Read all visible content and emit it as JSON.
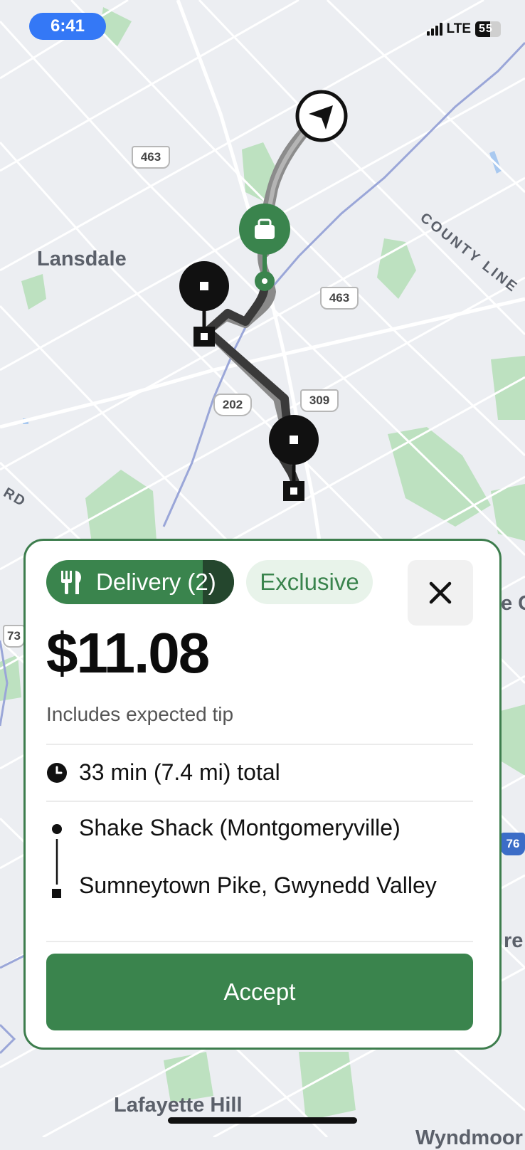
{
  "status_bar": {
    "time": "6:41",
    "network": "LTE",
    "battery": "55"
  },
  "map": {
    "places": [
      "Lansdale",
      "COUNTY LINE",
      "Lafayette Hill",
      "Wyndmoor",
      "RD"
    ],
    "route_shields": [
      "463",
      "463",
      "202",
      "309",
      "73",
      "76"
    ],
    "edge_fragments": [
      "e C",
      "re"
    ]
  },
  "offer": {
    "type_label": "Delivery (2)",
    "tag_label": "Exclusive",
    "price": "$11.08",
    "price_note": "Includes expected tip",
    "duration": "33 min (7.4 mi) total",
    "pickup": "Shake Shack (Montgomeryville)",
    "dropoff": "Sumneytown Pike, Gwynedd Valley",
    "accept_label": "Accept"
  },
  "icons": [
    "navigation-arrow-icon",
    "shopping-bag-icon",
    "fork-knife-icon",
    "close-icon",
    "clock-icon"
  ],
  "colors": {
    "accent_green": "#3a844d",
    "dark_green": "#24462d",
    "light_green": "#e8f3ea",
    "status_blue": "#3478f6",
    "park_green": "#b9dfbd"
  }
}
